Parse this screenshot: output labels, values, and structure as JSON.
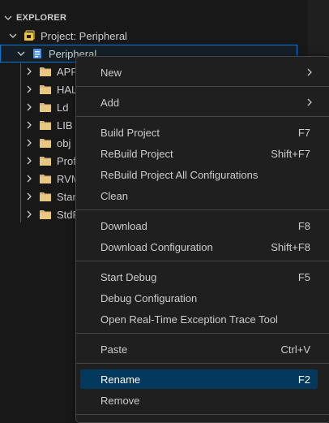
{
  "explorer": {
    "section_title": "EXPLORER",
    "project_label": "Project: Peripheral",
    "target_label": "Peripheral",
    "folders": [
      "APP",
      "HAL",
      "Ld",
      "LIB",
      "obj",
      "Prof",
      "RVM",
      "Star",
      "StdP"
    ]
  },
  "menu": {
    "new": "New",
    "add": "Add",
    "build": "Build Project",
    "build_kb": "F7",
    "rebuild": "ReBuild Project",
    "rebuild_kb": "Shift+F7",
    "rebuild_all": "ReBuild Project All Configurations",
    "clean": "Clean",
    "download": "Download",
    "download_kb": "F8",
    "download_config": "Download Configuration",
    "download_config_kb": "Shift+F8",
    "start_debug": "Start Debug",
    "start_debug_kb": "F5",
    "debug_config": "Debug Configuration",
    "exception_trace": "Open Real-Time Exception Trace Tool",
    "paste": "Paste",
    "paste_kb": "Ctrl+V",
    "rename": "Rename",
    "rename_kb": "F2",
    "remove": "Remove"
  },
  "colors": {
    "folder": "#dcb67a",
    "project_icon": "#e8c547",
    "target_icon": "#4a8ee8",
    "highlight": "#04395e",
    "focus_border": "#0078d4"
  }
}
